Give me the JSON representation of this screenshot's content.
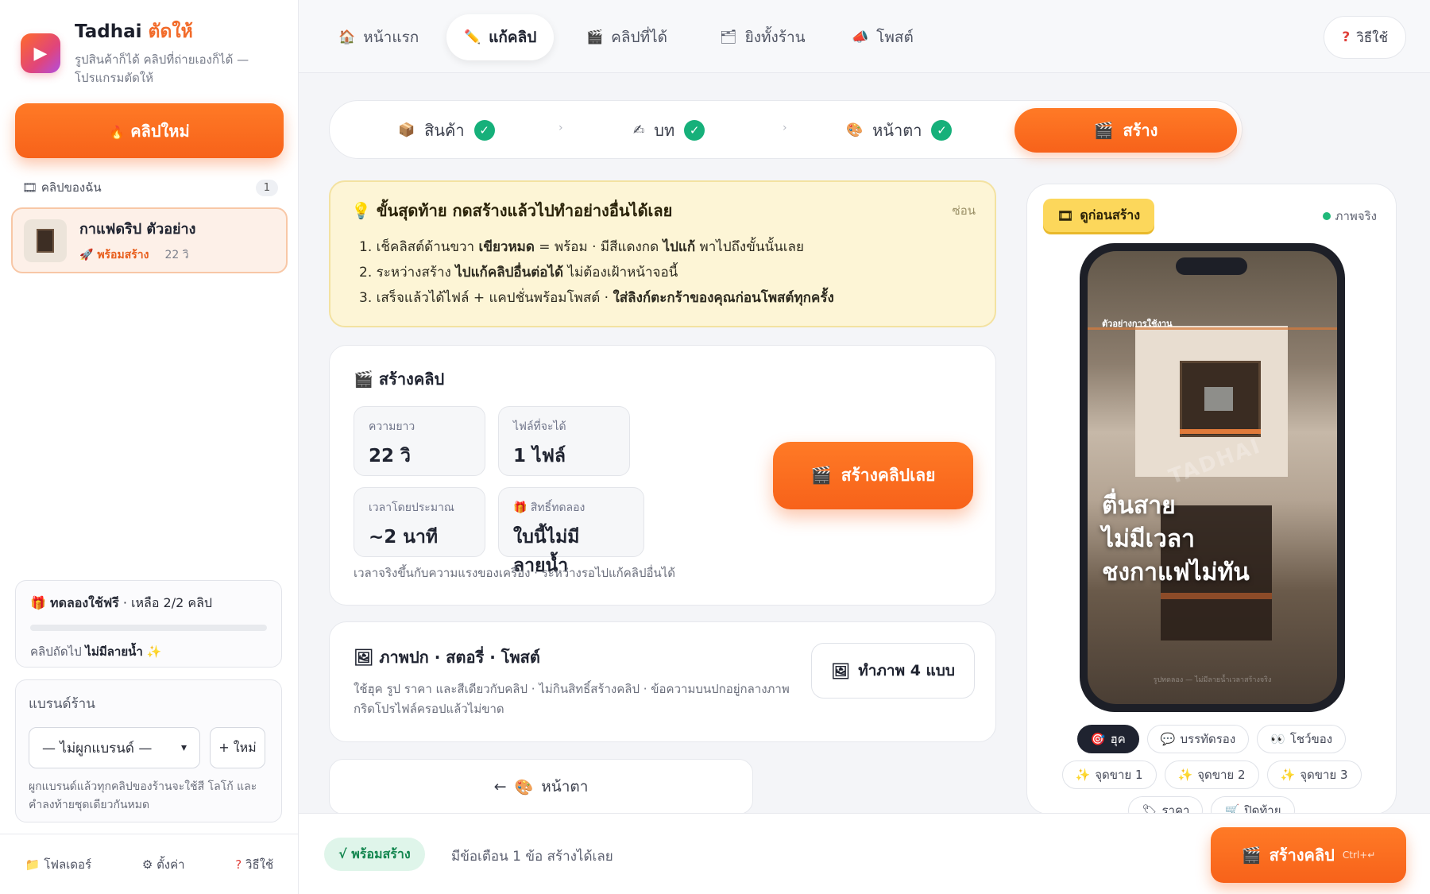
{
  "brand": {
    "name_main": "Tadhai",
    "name_accent": "ตัดให้",
    "tagline": "รูปสินค้าก็ได้ คลิปที่ถ่ายเองก็ได้ — โปรแกรมตัดให้"
  },
  "sidebar": {
    "new_clip_label": "คลิปใหม่",
    "my_clips_title": "คลิปของฉัน",
    "my_clips_count": "1",
    "clips": [
      {
        "name": "กาแฟดริป ตัวอย่าง",
        "status": "พร้อมสร้าง",
        "duration": "22 วิ"
      }
    ],
    "trial": {
      "title_bold": "ทดลองใช้ฟรี",
      "title_rest": " · เหลือ 2/2 คลิป",
      "remaining_fraction": 1.0,
      "foot_prefix": "คลิปถัดไป ",
      "foot_bold": "ไม่มีลายน้ำ"
    },
    "brand_box": {
      "title": "แบรนด์ร้าน",
      "selected": "— ไม่ผูกแบรนด์ —",
      "new_label": "+ ใหม่",
      "note": "ผูกแบรนด์แล้วทุกคลิปของร้านจะใช้สี โลโก้ และคำลงท้ายชุดเดียวกันหมด"
    },
    "footer": {
      "folder": "โฟลเดอร์",
      "settings": "ตั้งค่า",
      "help": "วิธีใช้"
    }
  },
  "topnav": {
    "tabs": [
      {
        "label": "หน้าแรก",
        "icon": "home-icon"
      },
      {
        "label": "แก้คลิป",
        "icon": "pencil-icon"
      },
      {
        "label": "คลิปที่ได้",
        "icon": "clapper-icon"
      },
      {
        "label": "ยิงทั้งร้าน",
        "icon": "folder-icon"
      },
      {
        "label": "โพสต์",
        "icon": "megaphone-icon"
      }
    ],
    "active_tab": 1,
    "help_label": "วิธีใช้"
  },
  "stepper": {
    "steps": [
      {
        "label": "สินค้า",
        "done": true
      },
      {
        "label": "บท",
        "done": true
      },
      {
        "label": "หน้าตา",
        "done": true
      },
      {
        "label": "สร้าง",
        "done": false
      }
    ],
    "active": 3
  },
  "info": {
    "title": "ขั้นสุดท้าย กดสร้างแล้วไปทำอย่างอื่นได้เลย",
    "hide_label": "ซ่อน",
    "items": [
      {
        "a": "1. เช็คลิสต์ด้านขวา ",
        "b": "เขียวหมด",
        "c": " = พร้อม · มีสีแดงกด ",
        "d": "ไปแก้",
        "e": " พาไปถึงขั้นนั้นเลย"
      },
      {
        "a": "2. ระหว่างสร้าง ",
        "b": "ไปแก้คลิปอื่นต่อได้",
        "c": " ไม่ต้องเฝ้าหน้าจอนี้",
        "d": "",
        "e": ""
      },
      {
        "a": "3. เสร็จแล้วได้ไฟล์ + แคปชั่นพร้อมโพสต์ · ",
        "b": "ใส่ลิงก์ตะกร้าของคุณก่อนโพสต์ทุกครั้ง",
        "c": "",
        "d": "",
        "e": ""
      }
    ]
  },
  "build": {
    "title": "สร้างคลิป",
    "stats": [
      {
        "label": "ความยาว",
        "value": "22 วิ"
      },
      {
        "label": "ไฟล์ที่จะได้",
        "value": "1 ไฟล์"
      },
      {
        "label": "เวลาโดยประมาณ",
        "value": "~2 นาที"
      },
      {
        "label": "สิทธิ์ทดลอง",
        "value": "ใบนี้ไม่มีลายน้ำ"
      }
    ],
    "button_label": "สร้างคลิปเลย",
    "note": "เวลาจริงขึ้นกับความแรงของเครื่อง · ระหว่างรอไปแก้คลิปอื่นได้"
  },
  "cover": {
    "title": "ภาพปก · สตอรี่ · โพสต์",
    "desc": "ใช้ฮุค รูป ราคา และสีเดียวกับคลิป · ไม่กินสิทธิ์สร้างคลิป · ข้อความบนปกอยู่กลางภาพ กริดโปรไฟล์ครอปแล้วไม่ขาด",
    "button_label": "ทำภาพ 4 แบบ"
  },
  "back_label": "หน้าตา",
  "preview": {
    "tag": "ดูก่อนสร้าง",
    "real_label": "ภาพจริง",
    "screen_label": "ตัวอย่างการใช้งาน",
    "watermark": "TADHAI",
    "hook_lines": [
      "ตื่นสาย",
      "ไม่มีเวลา",
      "ชงกาแฟไม่ทัน"
    ],
    "screen_foot": "รูปทดลอง — ไม่มีลายน้ำเวลาสร้างจริง",
    "chips_row1": [
      {
        "label": "ฮุค",
        "icon": "target-icon",
        "active": true
      },
      {
        "label": "บรรทัดรอง",
        "icon": "speech-bubble-icon",
        "active": false
      },
      {
        "label": "โชว์ของ",
        "icon": "eyes-icon",
        "active": false
      }
    ],
    "chips_row2": [
      {
        "label": "จุดขาย 1",
        "icon": "sparkle-icon"
      },
      {
        "label": "จุดขาย 2",
        "icon": "sparkle-icon"
      },
      {
        "label": "จุดขาย 3",
        "icon": "sparkle-icon"
      }
    ],
    "chips_row3": [
      {
        "label": "ราคา",
        "icon": "tag-icon"
      },
      {
        "label": "ปิดท้าย",
        "icon": "cart-icon"
      }
    ]
  },
  "bottom": {
    "ready_label": "√ พร้อมสร้าง",
    "message": "มีข้อเตือน 1 ข้อ สร้างได้เลย",
    "build_label": "สร้างคลิป",
    "shortcut": "Ctrl+↵"
  },
  "colors": {
    "accent": "#f7621a",
    "check_green": "#16b07a",
    "info_bg": "#fdf5d6"
  }
}
